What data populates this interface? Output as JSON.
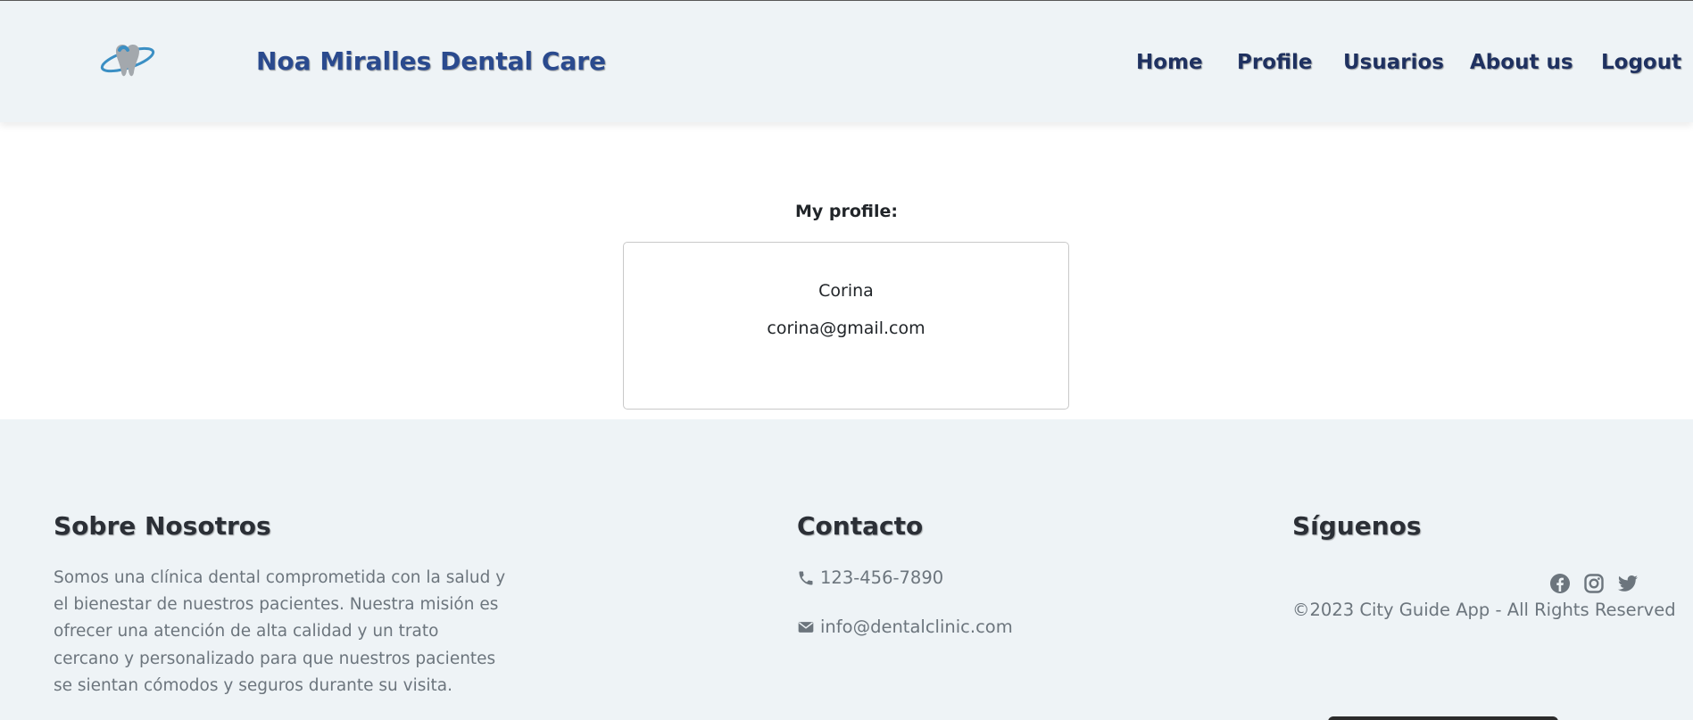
{
  "header": {
    "brand": "Noa Miralles Dental Care",
    "nav": [
      {
        "label": "Home"
      },
      {
        "label": "Profile"
      },
      {
        "label": "Usuarios"
      },
      {
        "label": "About us"
      },
      {
        "label": "Logout"
      }
    ]
  },
  "main": {
    "title": "My profile:",
    "profile": {
      "name": "Corina",
      "email": "corina@gmail.com"
    }
  },
  "footer": {
    "about": {
      "heading": "Sobre Nosotros",
      "text": "Somos una clínica dental comprometida con la salud y el bienestar de nuestros pacientes. Nuestra misión es ofrecer una atención de alta calidad y un trato cercano y personalizado para que nuestros pacientes se sientan cómodos y seguros durante su visita."
    },
    "contact": {
      "heading": "Contacto",
      "phone": "123-456-7890",
      "email": "info@dentalclinic.com"
    },
    "follow": {
      "heading": "Síguenos",
      "icons": [
        "facebook-icon",
        "instagram-icon",
        "twitter-icon"
      ],
      "copyright": "©2023 City Guide App - All Rights Reserved"
    }
  },
  "colors": {
    "brand": "#2a4a8e",
    "nav": "#1f3160",
    "header_bg": "#eef3f6",
    "muted_text": "#6c757d",
    "logo_blue": "#3b8fc4"
  }
}
